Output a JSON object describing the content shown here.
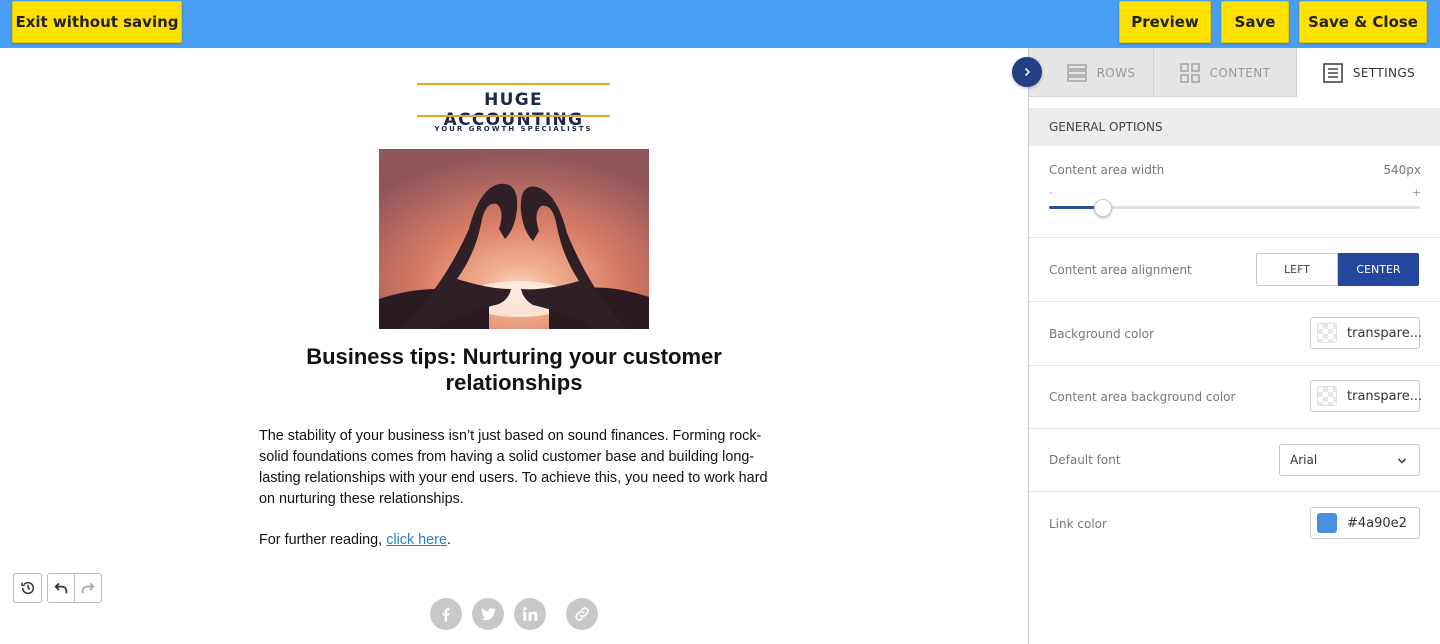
{
  "topbar": {
    "exit_label": "Exit without saving",
    "preview_label": "Preview",
    "save_label": "Save",
    "save_close_label": "Save & Close",
    "bg_color": "#4a9ff5",
    "button_color": "#ffe100"
  },
  "email": {
    "logo_name": "HUGE ACCOUNTING",
    "logo_tagline": "YOUR GROWTH SPECIALISTS",
    "title": "Business tips: Nurturing your customer relationships",
    "body": "The stability of your business isn’t just based on sound finances. Forming rock-solid foundations comes from having a solid customer base and building long-lasting relationships with your end users. To achieve this, you need to work hard on nurturing these relationships.",
    "reading_prefix": "For further reading, ",
    "reading_link": "click here",
    "reading_suffix": ".",
    "social_icons": [
      "facebook-icon",
      "twitter-icon",
      "linkedin-icon",
      "link-icon"
    ]
  },
  "history": {
    "icons": [
      "history-icon",
      "undo-icon",
      "redo-icon"
    ]
  },
  "panel": {
    "tabs": [
      {
        "label": "ROWS",
        "icon": "rows-icon",
        "active": false
      },
      {
        "label": "CONTENT",
        "icon": "content-grid-icon",
        "active": false
      },
      {
        "label": "SETTINGS",
        "icon": "settings-doc-icon",
        "active": true
      }
    ],
    "section_title": "GENERAL OPTIONS",
    "width": {
      "label": "Content area width",
      "value": "540px",
      "minus": "-",
      "plus": "+",
      "slider_fraction": 0.145
    },
    "alignment": {
      "label": "Content area alignment",
      "options": [
        "LEFT",
        "CENTER"
      ],
      "selected": "CENTER"
    },
    "background": {
      "label": "Background color",
      "value": "transpare..."
    },
    "content_background": {
      "label": "Content area background color",
      "value": "transpare..."
    },
    "font": {
      "label": "Default font",
      "value": "Arial"
    },
    "link_color": {
      "label": "Link color",
      "value": "#4a90e2",
      "swatch": "#4a90e2"
    },
    "accent_color": "#24479d"
  }
}
